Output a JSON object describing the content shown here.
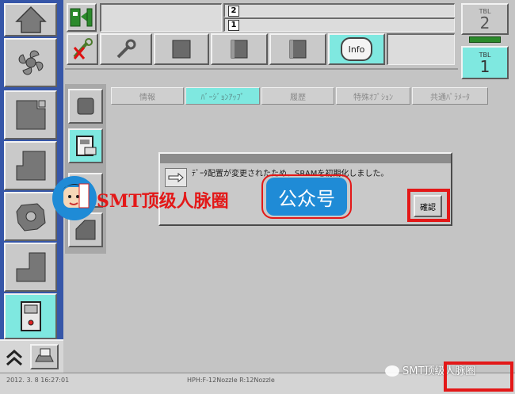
{
  "colors": {
    "accent_cyan": "#7fe8e0",
    "sidebar_blue": "#3656a8",
    "highlight_red": "#e31818",
    "watermark_blue": "#1f8bd6"
  },
  "toolbar": {
    "field_top_badge": "2",
    "field_bottom_badge": "1",
    "info_label": "Info",
    "icons": [
      "signal-green-icon",
      "cancel-wrench-icon",
      "wrench-icon",
      "square-icon",
      "book-icon",
      "book-icon",
      "info-icon"
    ]
  },
  "tbl_top": {
    "label": "TBL",
    "number": "2"
  },
  "tbl_bottom": {
    "label": "TBL",
    "number": "1"
  },
  "sidebar": {
    "items": [
      {
        "icon": "home-icon"
      },
      {
        "icon": "fan-icon"
      },
      {
        "icon": "block-icon"
      },
      {
        "icon": "block-icon"
      },
      {
        "icon": "gear-icon"
      },
      {
        "icon": "block-icon"
      },
      {
        "icon": "machine-icon",
        "active": true
      }
    ],
    "bottom_icons": [
      "double-chevron-up-icon",
      "printer-icon"
    ]
  },
  "tabs": [
    {
      "label": "情報",
      "active": false
    },
    {
      "label": "ﾊﾞｰｼﾞｮﾝｱｯﾌﾟ",
      "active": true
    },
    {
      "label": "履歴",
      "active": false
    },
    {
      "label": "特殊ｵﾌﾟｼｮﾝ",
      "active": false
    },
    {
      "label": "共通ﾊﾟﾗﾒｰﾀ",
      "active": false
    }
  ],
  "dialog": {
    "message": "ﾃﾞｰﾀ配置が変更されたため、SRAMを初期化しました。",
    "confirm_label": "確認"
  },
  "watermark": {
    "text": "SMT顶级人脉圈",
    "badge": "公众号",
    "avatar_text": "SMT 人脉圈",
    "wechat_text": "SMT顶级人脉圈"
  },
  "status_bar": {
    "left": "2012. 3. 8 16:27:01",
    "middle": "HPH:F-12Nozzle   R:12Nozzle"
  }
}
